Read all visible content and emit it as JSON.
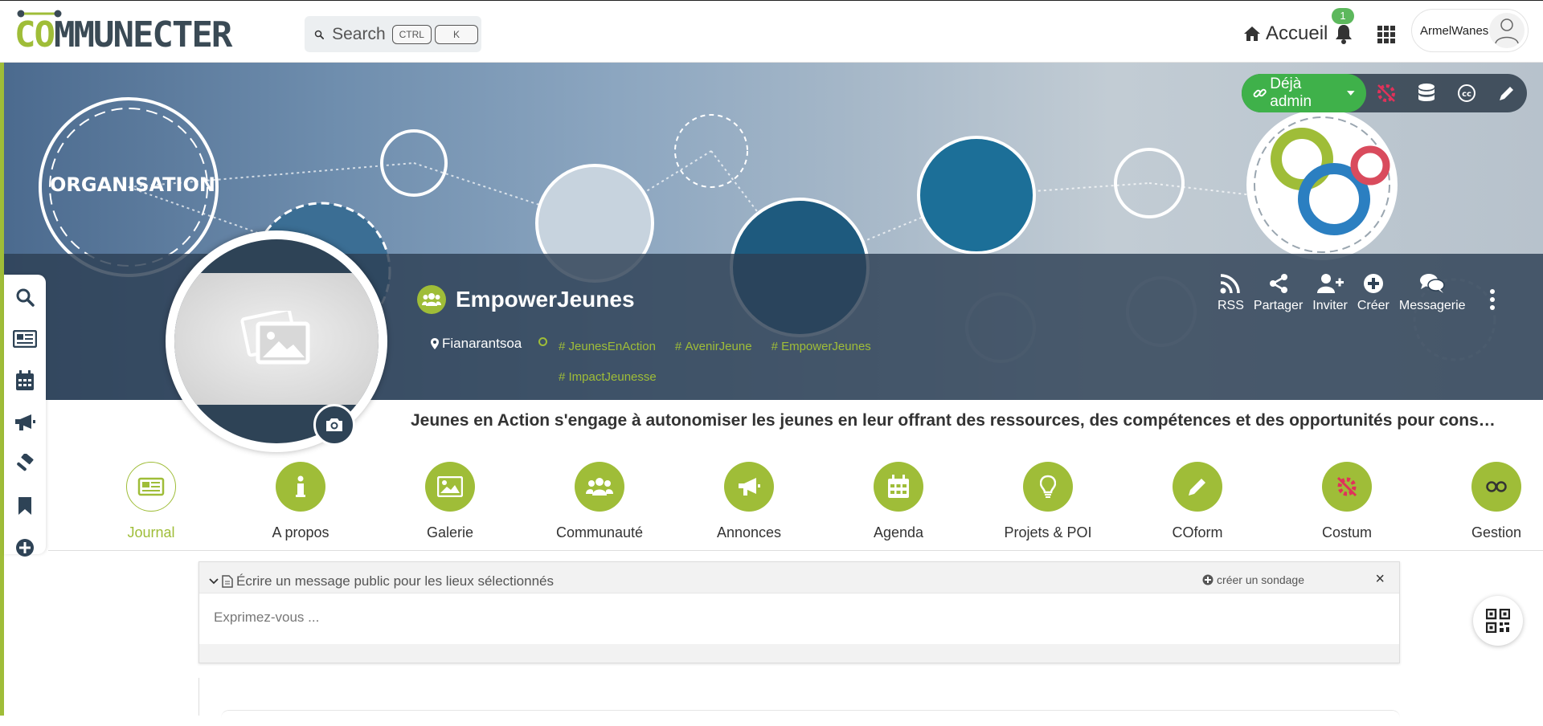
{
  "app": {
    "logo_prefix": "CO",
    "logo_suffix": "MMUNECTER"
  },
  "search": {
    "label": "Search",
    "kbd1": "CTRL",
    "kbd2": "K"
  },
  "nav": {
    "home_label": "Accueil",
    "notif_count": "1",
    "user_name": "ArmelWanes"
  },
  "banner": {
    "admin_label": "Déjà admin",
    "org_name": "EmpowerJeunes",
    "location": "Fianarantsoa",
    "tags": [
      "JeunesEnAction",
      "AvenirJeune",
      "EmpowerJeunes",
      "ImpactJeunesse"
    ],
    "banner_word": "ORGANISATION"
  },
  "actions": {
    "rss": "RSS",
    "share": "Partager",
    "invite": "Inviter",
    "create": "Créer",
    "messaging": "Messagerie"
  },
  "description": "Jeunes en Action s'engage à autonomiser les jeunes en leur offrant des ressources, des compétences et des opportunités pour construi…",
  "tabs": [
    {
      "label": "Journal",
      "icon": "newspaper-icon"
    },
    {
      "label": "A propos",
      "icon": "info-icon"
    },
    {
      "label": "Galerie",
      "icon": "image-icon"
    },
    {
      "label": "Communauté",
      "icon": "users-icon"
    },
    {
      "label": "Annonces",
      "icon": "bullhorn-icon"
    },
    {
      "label": "Agenda",
      "icon": "calendar-icon"
    },
    {
      "label": "Projets & POI",
      "icon": "lightbulb-icon"
    },
    {
      "label": "COform",
      "icon": "pencil-icon"
    },
    {
      "label": "Costum",
      "icon": "costum-icon"
    },
    {
      "label": "Gestion",
      "icon": "glasses-icon"
    }
  ],
  "composer": {
    "title": "Écrire un message public pour les lieux sélectionnés",
    "poll": "créer un sondage",
    "close": "×",
    "placeholder": "Exprimez-vous ..."
  },
  "colors": {
    "accent": "#9fbd38",
    "admin_green": "#3fb14a",
    "banner_dark": "#2d4054"
  }
}
